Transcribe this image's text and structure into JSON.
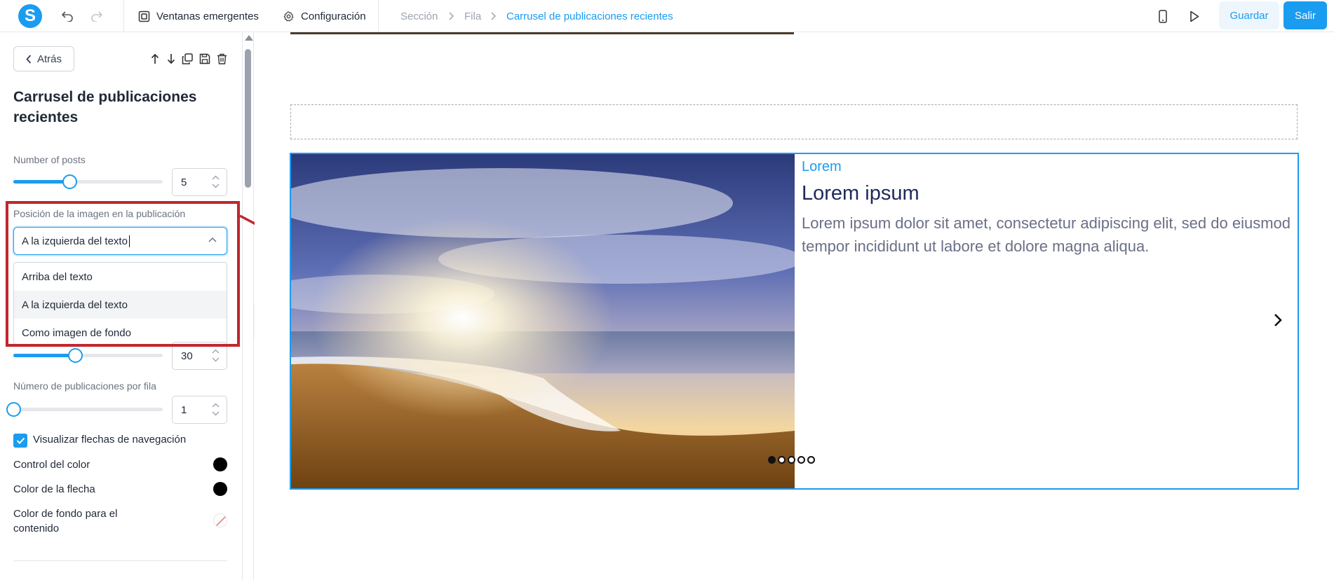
{
  "topbar": {
    "popups_label": "Ventanas emergentes",
    "settings_label": "Configuración",
    "breadcrumb": [
      "Sección",
      "Fila",
      "Carrusel de publicaciones recientes"
    ],
    "save_label": "Guardar",
    "exit_label": "Salir",
    "logo_letter": "S"
  },
  "sidebar": {
    "back_label": "Atrás",
    "title": "Carrusel de publicaciones recientes",
    "number_of_posts": {
      "label": "Number of posts",
      "value": "5",
      "level": 0.5
    },
    "image_position": {
      "label": "Posición de la imagen en la publicación",
      "value": "A la izquierda del texto",
      "options": [
        "Arriba del texto",
        "A la izquierda del texto",
        "Como imagen de fondo"
      ],
      "selected_index": 1
    },
    "hidden_slider": {
      "value": "30",
      "level": 0.55
    },
    "posts_per_row": {
      "label": "Número de publicaciones por fila",
      "value": "1",
      "level": 0
    },
    "show_nav_arrows": {
      "label": "Visualizar flechas de navegación",
      "checked": true
    },
    "control_color": {
      "label": "Control del color",
      "color": "#000000"
    },
    "arrow_color": {
      "label": "Color de la flecha",
      "color": "#000000"
    },
    "content_bg_color": {
      "label": "Color de fondo para el contenido"
    }
  },
  "canvas": {
    "post": {
      "category": "Lorem",
      "title": "Lorem ipsum",
      "body": "Lorem ipsum dolor sit amet, consectetur adipiscing elit, sed do eiusmod tempor incididunt ut labore et dolore magna aliqua."
    },
    "dots": {
      "count": 5,
      "active": 0
    }
  },
  "colors": {
    "accent": "#1a9cf0",
    "highlight": "#c0272d",
    "title": "#1e2a5a"
  }
}
